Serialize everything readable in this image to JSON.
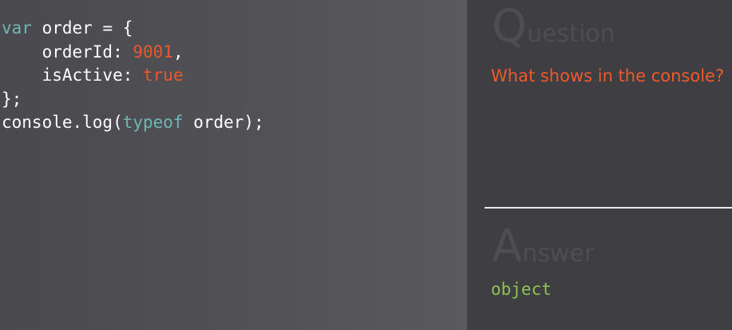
{
  "code": {
    "lines": [
      [
        {
          "text": "var",
          "kind": "keyword"
        },
        {
          "text": " order = {",
          "kind": "plain"
        }
      ],
      [
        {
          "text": "    orderId: ",
          "kind": "plain"
        },
        {
          "text": "9001",
          "kind": "number"
        },
        {
          "text": ",",
          "kind": "plain"
        }
      ],
      [
        {
          "text": "    isActive: ",
          "kind": "plain"
        },
        {
          "text": "true",
          "kind": "boolean"
        }
      ],
      [
        {
          "text": "};",
          "kind": "plain"
        }
      ],
      [
        {
          "text": "console.log(",
          "kind": "plain"
        },
        {
          "text": "typeof",
          "kind": "keyword"
        },
        {
          "text": " order);",
          "kind": "plain"
        }
      ]
    ]
  },
  "question": {
    "heading_initial": "Q",
    "heading_rest": "uestion",
    "text": "What shows in the console?"
  },
  "answer": {
    "heading_initial": "A",
    "heading_rest": "nswer",
    "text": "object"
  },
  "colors": {
    "keyword": "#6fb6b6",
    "number": "#e8582d",
    "boolean": "#e8582d",
    "question_text": "#ee5a2c",
    "answer_text": "#8ec44f"
  }
}
